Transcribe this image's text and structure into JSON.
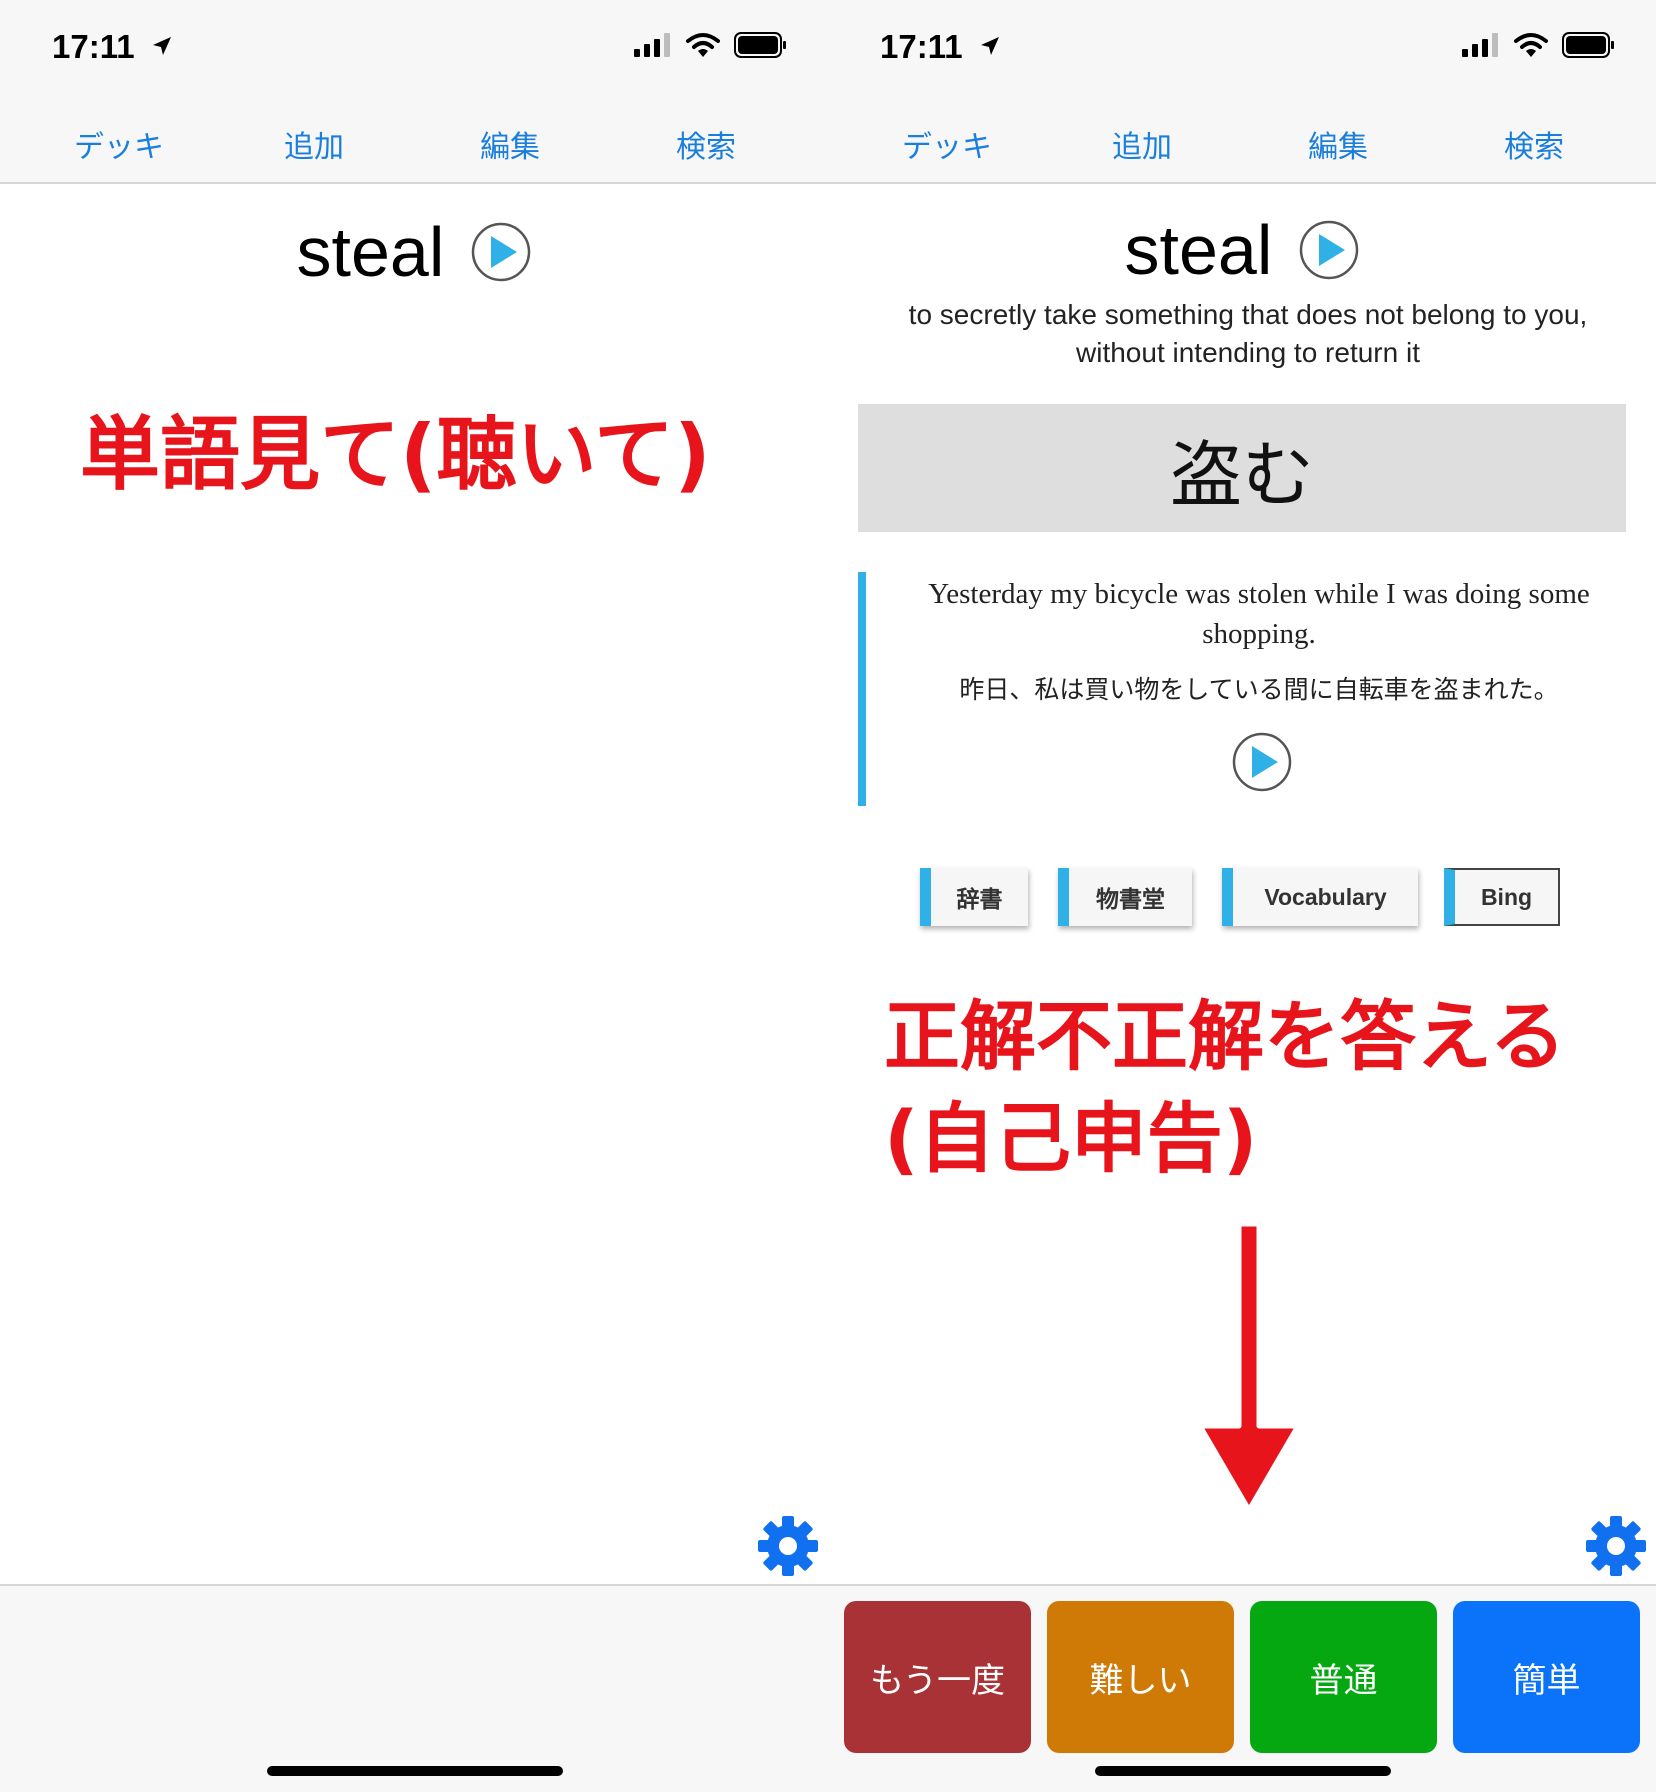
{
  "status_bar": {
    "time": "17:11"
  },
  "nav": {
    "items": [
      "デッキ",
      "追加",
      "編集",
      "検索"
    ]
  },
  "card": {
    "word": "steal",
    "definition_line1": "to secretly take something that does not belong to you,",
    "definition_line2": "without intending to return it",
    "answer": "盗む",
    "example_en": "Yesterday my bicycle was stolen while I was doing some shopping.",
    "example_ja": "昨日、私は買い物をしている間に自転車を盗まれた。",
    "links": [
      "辞書",
      "物書堂",
      "Vocabulary",
      "Bing"
    ]
  },
  "annotations": {
    "left": "単語見て(聴いて)",
    "right_line1": "正解不正解を答える",
    "right_line2": "(自己申告)"
  },
  "grades": [
    {
      "label": "もう一度",
      "color": "#a83236"
    },
    {
      "label": "難しい",
      "color": "#cf7a06"
    },
    {
      "label": "普通",
      "color": "#06a812"
    },
    {
      "label": "簡単",
      "color": "#0a73fa"
    }
  ],
  "colors": {
    "link_blue": "#1a7fdc",
    "accent_cyan": "#2fb0e6",
    "annotation_red": "#e8141b",
    "gear_blue": "#1170f0"
  },
  "icons": [
    "location-arrow-icon",
    "signal-icon",
    "wifi-icon",
    "battery-icon",
    "play-icon",
    "gear-icon",
    "down-arrow-icon"
  ]
}
